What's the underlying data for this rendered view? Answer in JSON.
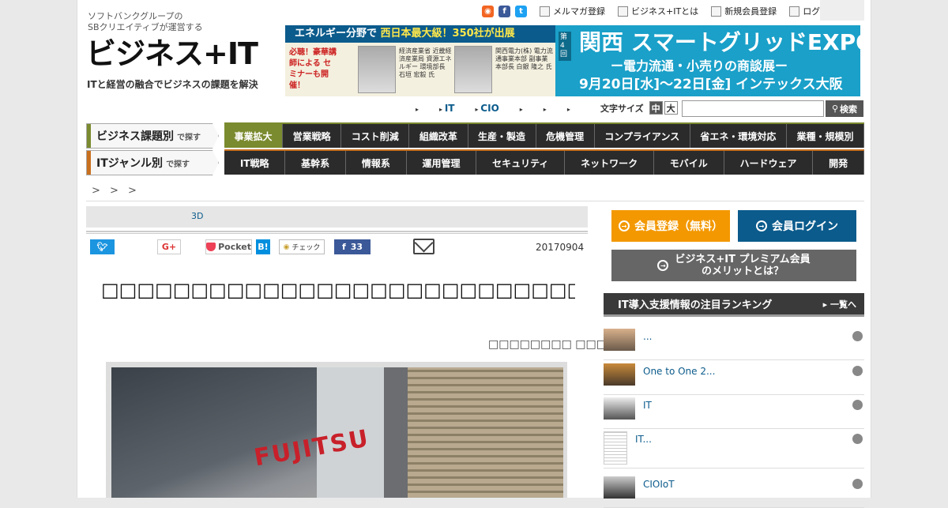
{
  "header": {
    "logo_sub1": "ソフトバンクグループの",
    "logo_sub2": "SBクリエイティブが運営する",
    "logo_main": "ビジネス+IT",
    "logo_tag": "ITと経営の融合でビジネスの課題を解決",
    "top_links": {
      "mailmag": "メルマガ登録",
      "about": "ビジネス+ITとは",
      "register": "新規会員登録",
      "login": "ログイン"
    }
  },
  "banner": {
    "left_bar_prefix": "エネルギー分野で",
    "left_bar_highlight": "西日本最大級！350社が出展",
    "left_note": "必聴！豪華講師による セミナーも開催！",
    "speaker1": "経済産業省 近畿経済産業局 資源エネルギー 環境部長 石垣 宏毅 氏",
    "speaker2": "関西電力(株) 電力流通事業本部 副事業本部長 白銀 隆之 氏",
    "side": "第4回",
    "title": "関西 スマートグリッドEXPO",
    "subtitle": "ー電力流通・小売りの商談展ー",
    "dates": "9月20日[水]〜22日[金] インテックス大阪"
  },
  "subnav": {
    "items": [
      "",
      "IT",
      "CIO",
      "",
      "",
      ""
    ],
    "font_size_label": "文字サイズ",
    "font_mid": "中",
    "font_large": "大",
    "search_label": "検索"
  },
  "categories": {
    "biz_label": "ビジネス課題別",
    "biz_sub": "で探す",
    "biz_items": [
      "事業拡大",
      "営業戦略",
      "コスト削減",
      "組織改革",
      "生産・製造",
      "危機管理",
      "コンプライアンス",
      "省エネ・環境対応",
      "業種・規模別"
    ],
    "it_label": "ITジャンル別",
    "it_sub": "で探す",
    "it_items": [
      "IT戦略",
      "基幹系",
      "情報系",
      "運用管理",
      "セキュリティ",
      "ネットワーク",
      "モバイル",
      "ハードウェア",
      "開発"
    ]
  },
  "breadcrumb": "> > >",
  "article": {
    "subbar_tag": "3D",
    "share": {
      "pocket": "Pocket",
      "hatena": "B!",
      "check": "チェック",
      "fb_count": "33"
    },
    "date": "20170904",
    "title": "□□□□□□□□□□□□□□□□□□□□□□□□□□□□□□□□□",
    "author": "□□□□□□□□ □□□□",
    "photo_sign": "FUJITSU"
  },
  "sidebar": {
    "register_btn": "会員登録（無料）",
    "login_btn": "会員ログイン",
    "premium_line1": "ビジネス+IT プレミアム会員",
    "premium_line2": "のメリットとは？",
    "ranking_title": "IT導入支援情報の注目ランキング",
    "ranking_more": "一覧へ",
    "ranking_items": [
      "...",
      "One to One 2...",
      "IT",
      "IT...",
      "CIOIoT"
    ]
  },
  "colors": {
    "accent_blue": "#0b5b8c",
    "biz_green": "#7a8a2e",
    "it_orange": "#c8701e",
    "register_orange": "#f39800"
  }
}
